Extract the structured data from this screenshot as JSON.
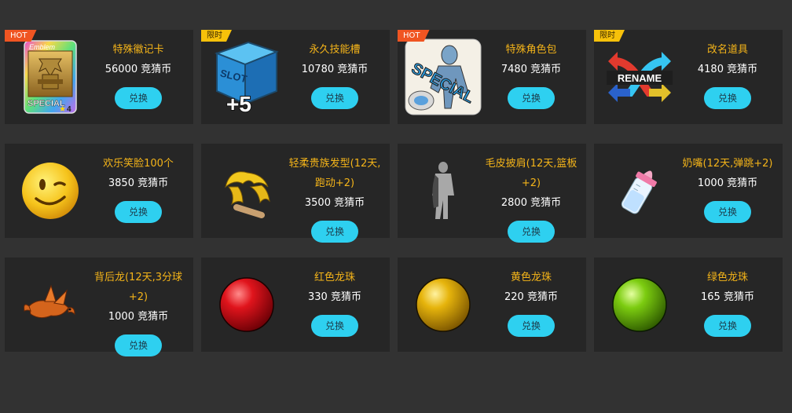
{
  "items": [
    {
      "tag": "HOT",
      "name": "特殊徽记卡",
      "price": "56000 竞猜币",
      "button": "兑换",
      "icon": "emblem-card-icon",
      "emblem_title": "Emblem",
      "emblem_label": "SPECIAL",
      "emblem_level": "4"
    },
    {
      "tag": "限时",
      "name": "永久技能槽",
      "price": "10780 竞猜币",
      "button": "兑换",
      "icon": "slot-box-icon",
      "slot_text": "SLOT",
      "slot_plus": "+5"
    },
    {
      "tag": "HOT",
      "name": "特殊角色包",
      "price": "7480 竞猜币",
      "button": "兑换",
      "icon": "special-character-pack-icon",
      "special_text": "SPECIAL"
    },
    {
      "tag": "限时",
      "name": "改名道具",
      "price": "4180 竞猜币",
      "button": "兑换",
      "icon": "rename-icon",
      "rename_text": "RENAME"
    },
    {
      "tag": "",
      "name": "欢乐笑脸100个",
      "price": "3850 竞猜币",
      "button": "兑换",
      "icon": "smiley-face-icon"
    },
    {
      "tag": "",
      "name": "轻柔贵族发型(12天,跑动+2)",
      "price": "3500 竞猜币",
      "button": "兑换",
      "icon": "hairstyle-icon"
    },
    {
      "tag": "",
      "name": "毛皮披肩(12天,篮板+2)",
      "price": "2800 竞猜币",
      "button": "兑换",
      "icon": "fur-shawl-icon"
    },
    {
      "tag": "",
      "name": "奶嘴(12天,弹跳+2)",
      "price": "1000 竞猜币",
      "button": "兑换",
      "icon": "baby-bottle-icon"
    },
    {
      "tag": "",
      "name": "背后龙(12天,3分球+2)",
      "price": "1000 竞猜币",
      "button": "兑换",
      "icon": "dragon-icon"
    },
    {
      "tag": "",
      "name": "红色龙珠",
      "price": "330 竞猜币",
      "button": "兑换",
      "icon": "red-orb-icon"
    },
    {
      "tag": "",
      "name": "黄色龙珠",
      "price": "220 竞猜币",
      "button": "兑换",
      "icon": "yellow-orb-icon"
    },
    {
      "tag": "",
      "name": "绿色龙珠",
      "price": "165 竞猜币",
      "button": "兑换",
      "icon": "green-orb-icon"
    }
  ],
  "colors": {
    "background": "#323232",
    "card": "#262626",
    "name": "#f4b419",
    "price": "#ffffff",
    "button": "#2ed0f0",
    "hot_tag": "#f05522",
    "limit_tag": "#f7c10a"
  }
}
